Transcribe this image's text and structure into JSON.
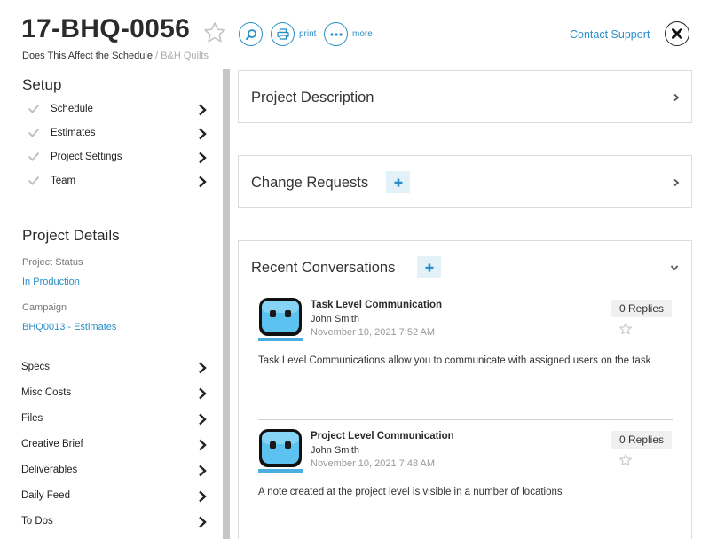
{
  "header": {
    "project_id": "17-BHQ-0056",
    "project_name": "Does This Affect the Schedule",
    "breadcrumb_sep": "/",
    "client": "B&H Quilts",
    "print_label": "print",
    "more_label": "more",
    "contact_label": "Contact Support"
  },
  "setup": {
    "title": "Setup",
    "items": [
      {
        "label": "Schedule"
      },
      {
        "label": "Estimates"
      },
      {
        "label": "Project Settings"
      },
      {
        "label": "Team"
      }
    ]
  },
  "details": {
    "title": "Project Details",
    "status_label": "Project Status",
    "status_value": "In Production",
    "campaign_label": "Campaign",
    "campaign_value": "BHQ0013 - Estimates"
  },
  "nav": {
    "items": [
      {
        "label": "Specs"
      },
      {
        "label": "Misc Costs"
      },
      {
        "label": "Files"
      },
      {
        "label": "Creative Brief"
      },
      {
        "label": "Deliverables"
      },
      {
        "label": "Daily Feed"
      },
      {
        "label": "To Dos"
      }
    ]
  },
  "panels": {
    "description_title": "Project Description",
    "change_requests_title": "Change Requests",
    "conversations_title": "Recent Conversations"
  },
  "conversations": [
    {
      "title": "Task Level Communication",
      "author": "John Smith",
      "date": "November 10, 2021 7:52 AM",
      "replies": "0 Replies",
      "body": "Task Level Communications allow you to communicate with assigned users on the task"
    },
    {
      "title": "Project Level Communication",
      "author": "John Smith",
      "date": "November 10, 2021 7:48 AM",
      "replies": "0 Replies",
      "body": "A note created at the project level is visible in a number of locations"
    }
  ],
  "colors": {
    "accent": "#2a8fc7",
    "sidebar_divider": "#c6c6c6",
    "plus_bg": "#e3f1f9"
  },
  "icons": {
    "favorite": "star-outline-icon",
    "search": "search-icon",
    "print": "printer-icon",
    "more": "more-dots-icon",
    "close": "close-icon",
    "check": "check-icon",
    "chevron": "chevron-right-icon",
    "add": "plus-icon",
    "avatar": "robot-avatar-icon"
  }
}
